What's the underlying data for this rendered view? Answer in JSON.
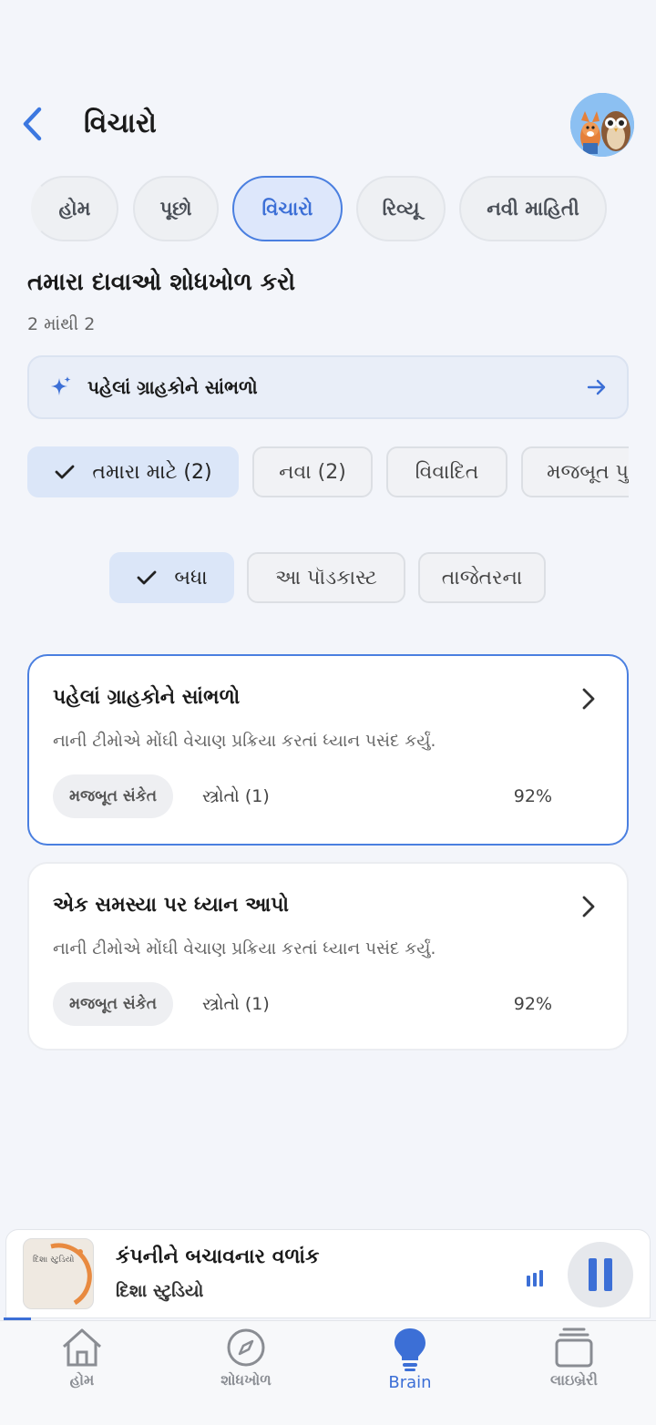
{
  "header": {
    "title": "વિચારો"
  },
  "tabs": [
    {
      "label": "હોમ"
    },
    {
      "label": "પૂછો"
    },
    {
      "label": "વિચારો",
      "active": true
    },
    {
      "label": "રિવ્યૂ"
    },
    {
      "label": "નવી માહિતી"
    }
  ],
  "section": {
    "title": "તમારા દાવાઓ શોધખોળ કરો",
    "count": "2 માંથી 2"
  },
  "suggestion": {
    "label": "પહેલાં ગ્રાહકોને સાંભળો"
  },
  "filters": [
    {
      "label": "તમારા માટે (2)",
      "selected": true
    },
    {
      "label": "નવા (2)"
    },
    {
      "label": "વિવાદિત"
    },
    {
      "label": "મજબૂત પુ"
    }
  ],
  "scope": [
    {
      "label": "બધા",
      "selected": true
    },
    {
      "label": "આ પૉડકાસ્ટ"
    },
    {
      "label": "તાજેતરના"
    }
  ],
  "cards": [
    {
      "title": "પહેલાં ગ્રાહકોને સાંભળો",
      "desc": "નાની ટીમોએ મોંઘી વેચાણ પ્રક્રિયા કરતાં ધ્યાન પસંદ કર્યું.",
      "badge": "મજબૂત સંકેત",
      "sources": "સ્ત્રોતો (1)",
      "confidence": "92%",
      "selected": true
    },
    {
      "title": "એક સમસ્યા પર ધ્યાન આપો",
      "desc": "નાની ટીમોએ મોંઘી વેચાણ પ્રક્રિયા કરતાં ધ્યાન પસંદ કર્યું.",
      "badge": "મજબૂત સંકેત",
      "sources": "સ્ત્રોતો (1)",
      "confidence": "92%"
    }
  ],
  "player": {
    "title": "કંપનીને બચાવનાર વળાંક",
    "subtitle": "દિશા સ્ટુડિયો",
    "thumb_text": "દિશા સ્ટુડિયો"
  },
  "nav": [
    {
      "label": "હોમ",
      "icon": "home-icon"
    },
    {
      "label": "શોધખોળ",
      "icon": "compass-icon"
    },
    {
      "label": "Brain",
      "icon": "lightbulb-icon",
      "active": true
    },
    {
      "label": "લાઇબ્રેરી",
      "icon": "library-icon"
    }
  ],
  "colors": {
    "accent": "#3c6fd6",
    "background": "#f3f5fa"
  }
}
